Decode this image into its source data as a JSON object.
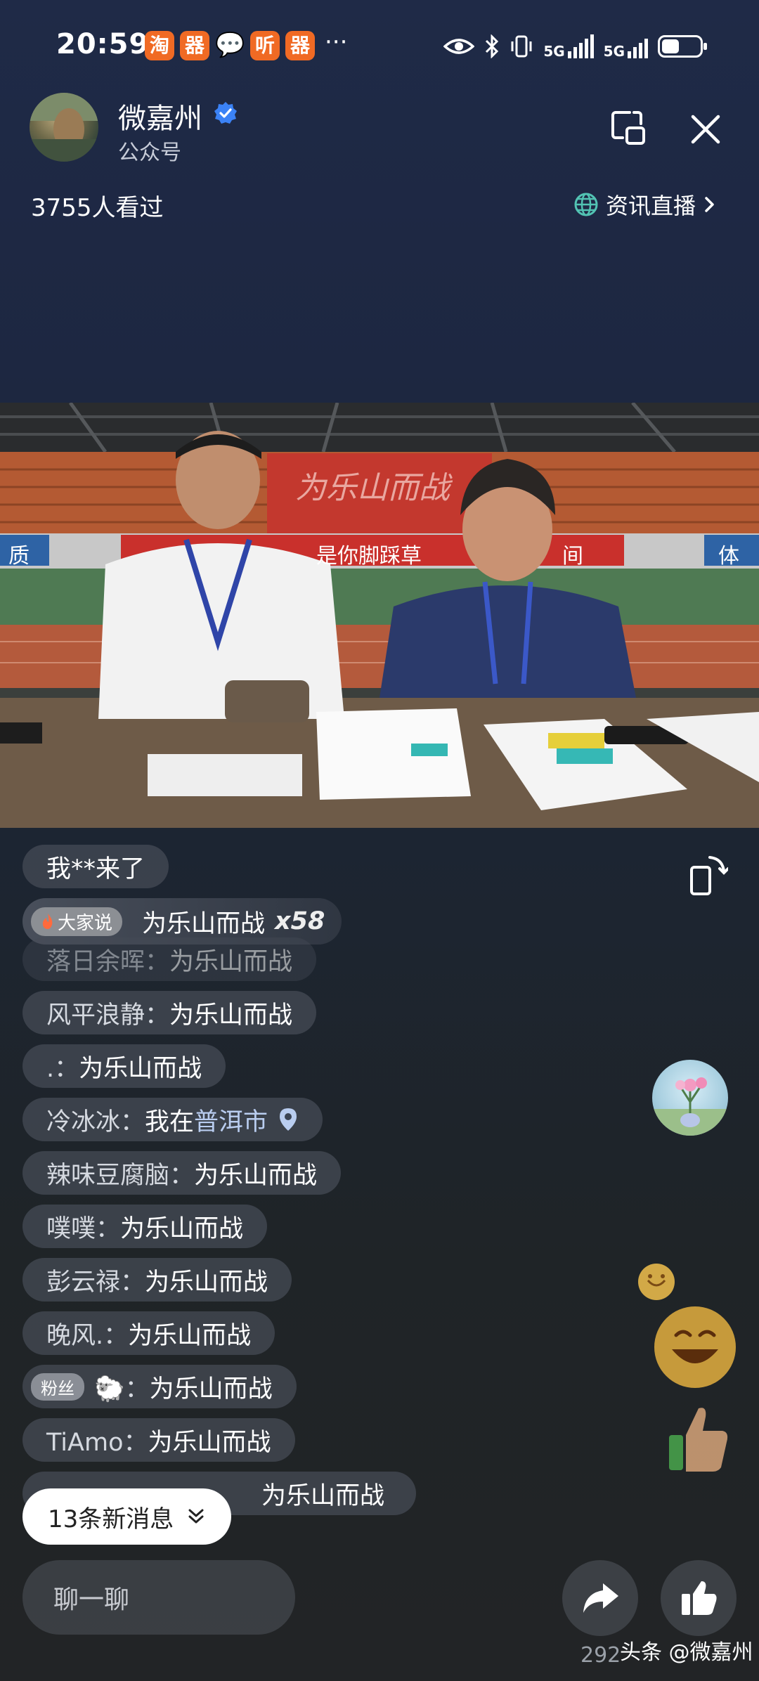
{
  "status_bar": {
    "time": "20:59",
    "badges": [
      "淘",
      "器",
      "听",
      "器"
    ],
    "more": "···",
    "network": "5G"
  },
  "header": {
    "channel_name": "微嘉州",
    "channel_type": "公众号",
    "viewers": "3755人看过",
    "category": "资讯直播"
  },
  "video": {
    "banner_text": "是你脚踩草",
    "banner_text_right": "间",
    "sign_left": "质",
    "sign_right": "体",
    "stands_text": "为乐山而战"
  },
  "chat": {
    "messages": [
      {
        "user": "我**",
        "text": " 来了",
        "plain": true
      },
      {
        "tag": "大家说",
        "text": "为乐山而战",
        "count": "x58",
        "highlight": true
      },
      {
        "user": "落日余晖：",
        "text": "为乐山而战",
        "faded": true
      },
      {
        "user": "风平浪静：",
        "text": "为乐山而战"
      },
      {
        "user": ".：",
        "text": "为乐山而战"
      },
      {
        "user": "冷冰冰：",
        "text": "我在 ",
        "location": "普洱市"
      },
      {
        "user": "辣味豆腐脑：",
        "text": "为乐山而战"
      },
      {
        "user": "噗噗：",
        "text": "为乐山而战"
      },
      {
        "user": "彭云禄：",
        "text": "为乐山而战"
      },
      {
        "user": "晚风.：",
        "text": "为乐山而战"
      },
      {
        "tag": "粉丝",
        "user": "🐑：",
        "text": "为乐山而战"
      },
      {
        "user": "TiAmo：",
        "text": "为乐山而战"
      },
      {
        "user": "",
        "text": "为乐山而战"
      }
    ],
    "new_messages_label": "13条新消息",
    "input_placeholder": "聊一聊"
  },
  "footer": {
    "counter": "292",
    "watermark": "头条 @微嘉州"
  },
  "colors": {
    "accent_orange": "#f06a24",
    "verified_blue": "#3b82f6"
  }
}
